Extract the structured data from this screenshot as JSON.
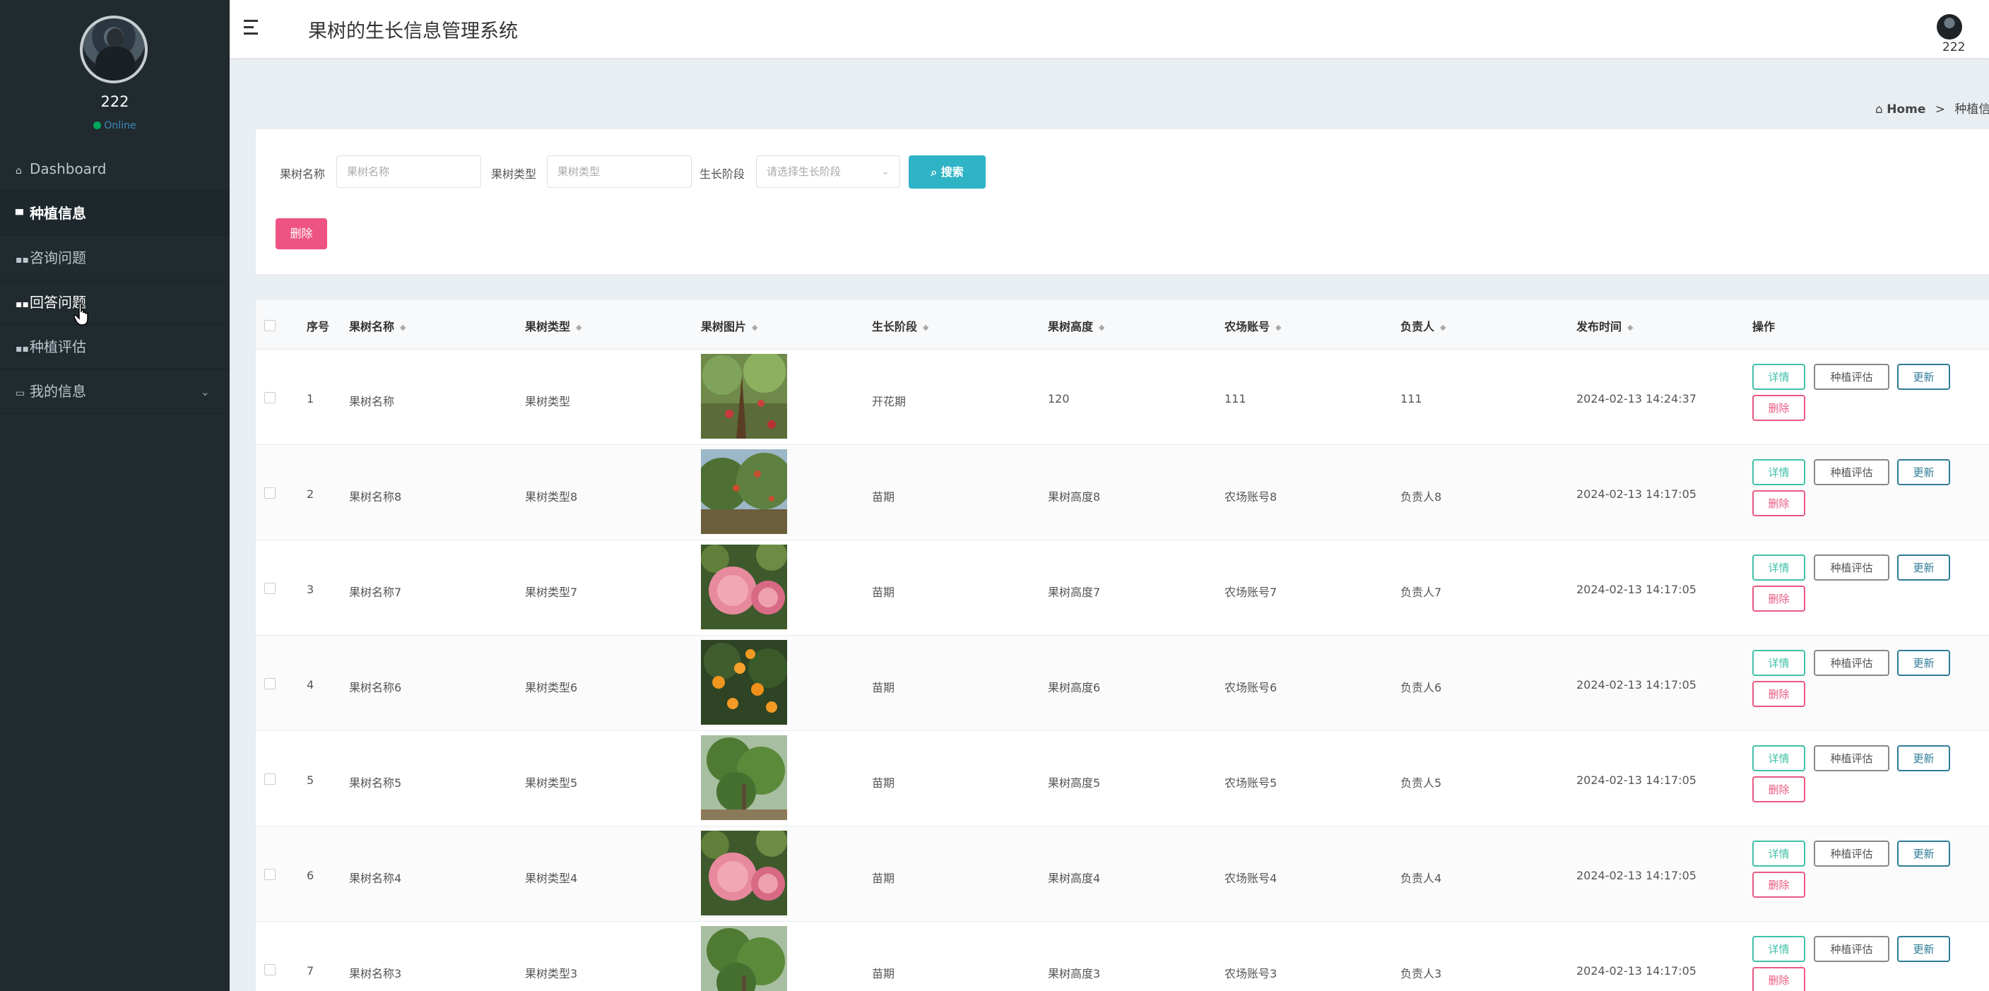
{
  "sidebar": {
    "username": "222",
    "status": "Online",
    "menu": [
      {
        "label": "Dashboard",
        "icon": "home-icon"
      },
      {
        "label": "种植信息",
        "icon": "monitor-icon"
      },
      {
        "label": "咨询问题",
        "icon": "grid-icon"
      },
      {
        "label": "回答问题",
        "icon": "grid-icon"
      },
      {
        "label": "种植评估",
        "icon": "grid-icon"
      },
      {
        "label": "我的信息",
        "icon": "card-icon"
      }
    ]
  },
  "header": {
    "title": "果树的生长信息管理系统",
    "user": "222"
  },
  "breadcrumb": {
    "home": "Home",
    "current": "种植信"
  },
  "search": {
    "name_label": "果树名称",
    "name_placeholder": "果树名称",
    "type_label": "果树类型",
    "type_placeholder": "果树类型",
    "stage_label": "生长阶段",
    "stage_placeholder": "请选择生长阶段",
    "search_button": "搜索",
    "delete_button": "删除"
  },
  "table": {
    "headers": {
      "index": "序号",
      "name": "果树名称",
      "type": "果树类型",
      "image": "果树图片",
      "stage": "生长阶段",
      "height": "果树高度",
      "account": "农场账号",
      "owner": "负责人",
      "time": "发布时间",
      "action": "操作"
    },
    "actions": {
      "detail": "详情",
      "evaluate": "种植评估",
      "update": "更新",
      "delete": "删除"
    },
    "rows": [
      {
        "index": "1",
        "name": "果树名称",
        "type": "果树类型",
        "stage": "开花期",
        "height": "120",
        "account": "111",
        "owner": "111",
        "time": "2024-02-13 14:24:37",
        "img": "apple-tree"
      },
      {
        "index": "2",
        "name": "果树名称8",
        "type": "果树类型8",
        "stage": "苗期",
        "height": "果树高度8",
        "account": "农场账号8",
        "owner": "负责人8",
        "time": "2024-02-13 14:17:05",
        "img": "orchard"
      },
      {
        "index": "3",
        "name": "果树名称7",
        "type": "果树类型7",
        "stage": "苗期",
        "height": "果树高度7",
        "account": "农场账号7",
        "owner": "负责人7",
        "time": "2024-02-13 14:17:05",
        "img": "apples"
      },
      {
        "index": "4",
        "name": "果树名称6",
        "type": "果树类型6",
        "stage": "苗期",
        "height": "果树高度6",
        "account": "农场账号6",
        "owner": "负责人6",
        "time": "2024-02-13 14:17:05",
        "img": "oranges"
      },
      {
        "index": "5",
        "name": "果树名称5",
        "type": "果树类型5",
        "stage": "苗期",
        "height": "果树高度5",
        "account": "农场账号5",
        "owner": "负责人5",
        "time": "2024-02-13 14:17:05",
        "img": "young-tree"
      },
      {
        "index": "6",
        "name": "果树名称4",
        "type": "果树类型4",
        "stage": "苗期",
        "height": "果树高度4",
        "account": "农场账号4",
        "owner": "负责人4",
        "time": "2024-02-13 14:17:05",
        "img": "apples"
      },
      {
        "index": "7",
        "name": "果树名称3",
        "type": "果树类型3",
        "stage": "苗期",
        "height": "果树高度3",
        "account": "农场账号3",
        "owner": "负责人3",
        "time": "2024-02-13 14:17:05",
        "img": "young-tree"
      }
    ]
  },
  "colors": {
    "sidebar_bg": "#212a2e",
    "search_button": "#2fb4c5",
    "delete_button": "#ef5383",
    "detail": "#41c0a8",
    "update": "#2e7b96"
  }
}
